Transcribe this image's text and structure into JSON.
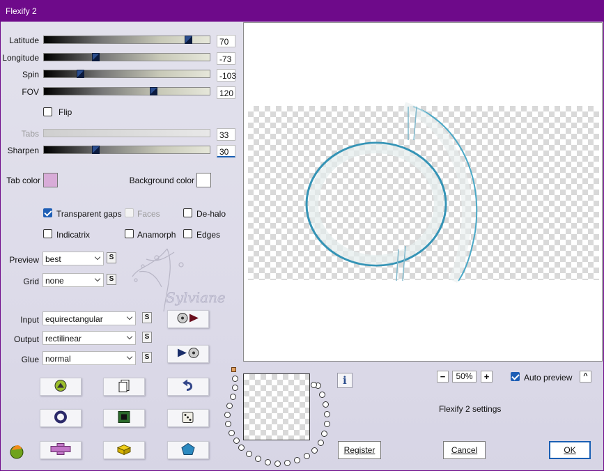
{
  "window": {
    "title": "Flexify 2"
  },
  "sliders": [
    {
      "label": "Latitude",
      "value": "70",
      "position": 0.87
    },
    {
      "label": "Longitude",
      "value": "-73",
      "position": 0.31
    },
    {
      "label": "Spin",
      "value": "-103",
      "position": 0.22
    },
    {
      "label": "FOV",
      "value": "120",
      "position": 0.66
    },
    {
      "label": "Tabs",
      "value": "33",
      "position": 0,
      "disabled": true
    },
    {
      "label": "Sharpen",
      "value": "30",
      "position": 0.31
    }
  ],
  "flip": {
    "label": "Flip",
    "checked": false
  },
  "colors": {
    "tab_label": "Tab color",
    "tab_color": "#d8acd8",
    "background_label": "Background color",
    "background_color": "#ffffff"
  },
  "options": {
    "transparent_gaps": "Transparent gaps",
    "faces": "Faces",
    "de_halo": "De-halo",
    "indicatrix": "Indicatrix",
    "anamorph": "Anamorph",
    "edges": "Edges"
  },
  "dropdowns": {
    "preview": {
      "label": "Preview",
      "value": "best"
    },
    "grid": {
      "label": "Grid",
      "value": "none"
    },
    "input": {
      "label": "Input",
      "value": "equirectangular"
    },
    "output": {
      "label": "Output",
      "value": "rectilinear"
    },
    "glue": {
      "label": "Glue",
      "value": "normal"
    }
  },
  "small_button_label": "S",
  "watermark": "Sylviane",
  "zoom": {
    "value": "50%",
    "minus": "−",
    "plus": "+"
  },
  "auto_preview": {
    "label": "Auto preview",
    "checked": true,
    "caret": "^"
  },
  "settings_text": "Flexify 2 settings",
  "info_glyph": "i",
  "buttons": {
    "register": "Register",
    "cancel": "Cancel",
    "ok": "OK"
  }
}
